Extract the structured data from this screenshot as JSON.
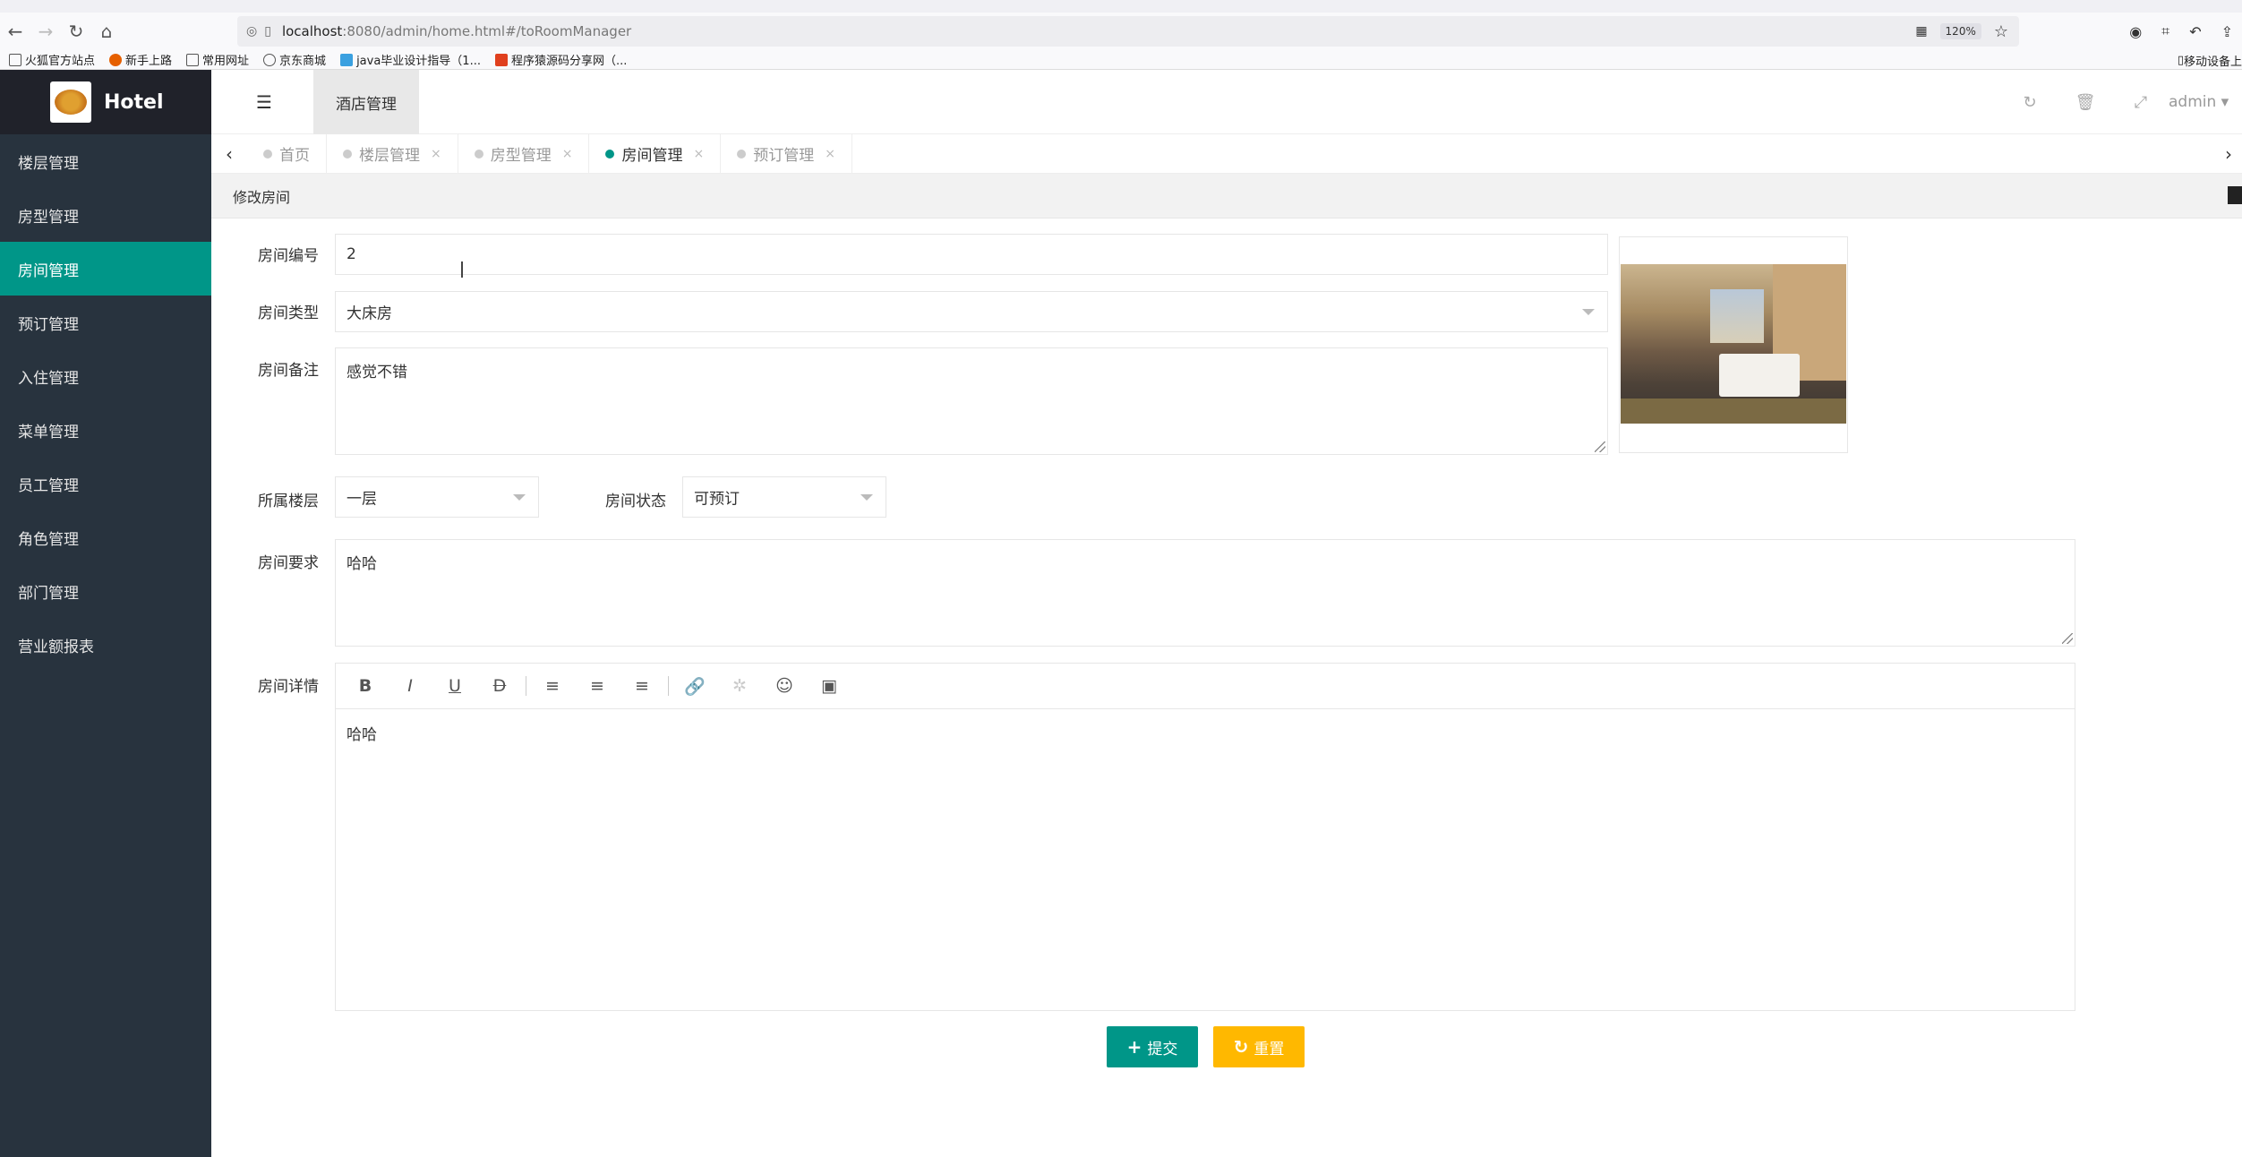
{
  "browser": {
    "url_host": "localhost",
    "url_rest": ":8080/admin/home.html#/toRoomManager",
    "zoom": "120%",
    "bookmarks": [
      "火狐官方站点",
      "新手上路",
      "常用网址",
      "京东商城",
      "java毕业设计指导（1...",
      "程序猿源码分享网（..."
    ],
    "bookmark_right": "移动设备上"
  },
  "sidebar": {
    "logo_text": "Hotel",
    "items": [
      {
        "label": "楼层管理",
        "active": false
      },
      {
        "label": "房型管理",
        "active": false
      },
      {
        "label": "房间管理",
        "active": true
      },
      {
        "label": "预订管理",
        "active": false
      },
      {
        "label": "入住管理",
        "active": false
      },
      {
        "label": "菜单管理",
        "active": false
      },
      {
        "label": "员工管理",
        "active": false
      },
      {
        "label": "角色管理",
        "active": false
      },
      {
        "label": "部门管理",
        "active": false
      },
      {
        "label": "营业额报表",
        "active": false
      }
    ]
  },
  "header": {
    "tab_label": "酒店管理",
    "user": "admin"
  },
  "tabs": [
    {
      "label": "首页",
      "active": false,
      "closable": false
    },
    {
      "label": "楼层管理",
      "active": false,
      "closable": true
    },
    {
      "label": "房型管理",
      "active": false,
      "closable": true
    },
    {
      "label": "房间管理",
      "active": true,
      "closable": true
    },
    {
      "label": "预订管理",
      "active": false,
      "closable": true
    }
  ],
  "page": {
    "title": "修改房间"
  },
  "form": {
    "room_no_label": "房间编号",
    "room_no_value": "2",
    "room_type_label": "房间类型",
    "room_type_value": "大床房",
    "remark_label": "房间备注",
    "remark_value": "感觉不错",
    "floor_label": "所属楼层",
    "floor_value": "一层",
    "status_label": "房间状态",
    "status_value": "可预订",
    "require_label": "房间要求",
    "require_value": "哈哈",
    "detail_label": "房间详情",
    "detail_value": "哈哈"
  },
  "buttons": {
    "submit": "提交",
    "reset": "重置"
  },
  "colors": {
    "accent": "#009688",
    "warning": "#ffb800",
    "sidebar": "#28333e"
  }
}
